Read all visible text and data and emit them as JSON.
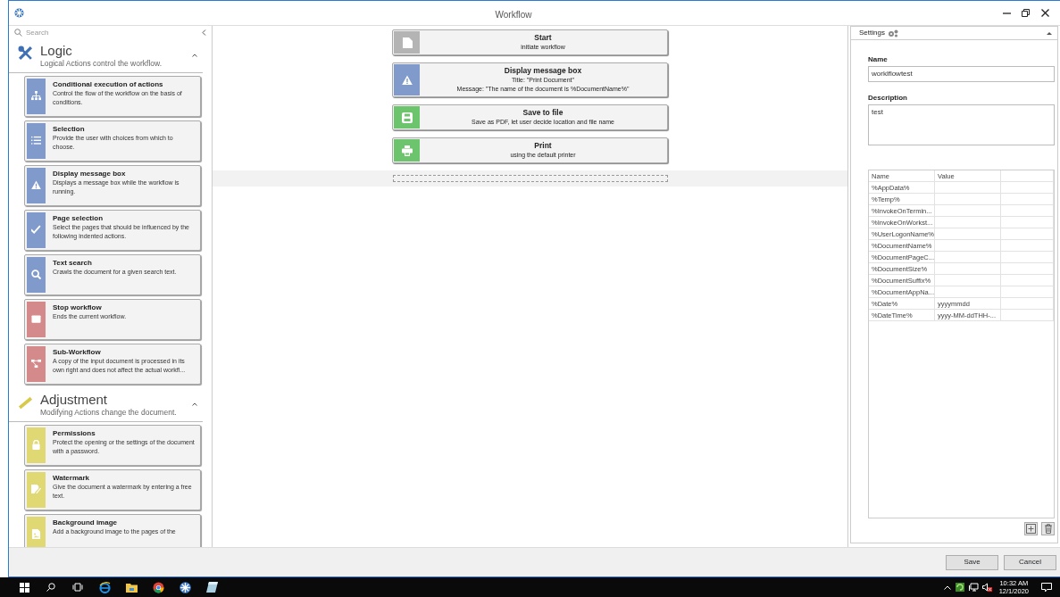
{
  "window": {
    "title": "Workflow"
  },
  "toolbox": {
    "search": {
      "placeholder": "Search"
    },
    "sections": [
      {
        "title": "Logic",
        "subtitle": "Logical Actions control the workflow.",
        "expanded": true,
        "items": [
          {
            "title": "Conditional execution of actions",
            "description": "Control the flow of the workflow on the basis of conditions.",
            "color": "#7f9acb"
          },
          {
            "title": "Selection",
            "description": "Provide the user with choices from which to choose.",
            "color": "#7f9acb"
          },
          {
            "title": "Display message box",
            "description": "Displays a message box while the workflow is running.",
            "color": "#7f9acb"
          },
          {
            "title": "Page selection",
            "description": "Select the pages that should be influenced by the following indented actions.",
            "color": "#7f9acb"
          },
          {
            "title": "Text search",
            "description": "Crawls the document for a given search text.",
            "color": "#7f9acb"
          },
          {
            "title": "Stop workflow",
            "description": "Ends the current workflow.",
            "color": "#d48a8a"
          },
          {
            "title": "Sub-Workflow",
            "description": "A copy of the input document is processed in its own right and does not affect the actual workfl...",
            "color": "#d48a8a"
          }
        ]
      },
      {
        "title": "Adjustment",
        "subtitle": "Modifying Actions change the document.",
        "expanded": true,
        "items": [
          {
            "title": "Permissions",
            "description": "Protect the opening or the settings of the document with a password.",
            "color": "#e0d872"
          },
          {
            "title": "Watermark",
            "description": "Give the document a watermark by entering a free text.",
            "color": "#e0d872"
          },
          {
            "title": "Background image",
            "description": "Add a background image to the pages of the",
            "color": "#e0d872"
          }
        ]
      }
    ]
  },
  "workflow": {
    "steps": [
      {
        "title": "Start",
        "lines": [
          "initiate workflow"
        ],
        "color": "#b4b4b4"
      },
      {
        "title": "Display message box",
        "lines": [
          "Title: \"Print Document\"",
          "Message: \"The name of the document is %DocumentName%\""
        ],
        "color": "#7f9acb"
      },
      {
        "title": "Save to file",
        "lines": [
          "Save as PDF, let user decide location and file name"
        ],
        "color": "#6cc46c"
      },
      {
        "title": "Print",
        "lines": [
          "using the default printer"
        ],
        "color": "#6cc46c"
      }
    ]
  },
  "settings": {
    "title": "Settings",
    "expanded": true,
    "name_label": "Name",
    "name_value": "worklflowtest",
    "description_label": "Description",
    "description_value": "test",
    "variables": {
      "columns": [
        "Name",
        "Value"
      ],
      "rows": [
        {
          "name": "%AppData%",
          "value": ""
        },
        {
          "name": "%Temp%",
          "value": ""
        },
        {
          "name": "%InvokeOnTermin...",
          "value": ""
        },
        {
          "name": "%InvokeOnWorkst...",
          "value": ""
        },
        {
          "name": "%UserLogonName%",
          "value": ""
        },
        {
          "name": "%DocumentName%",
          "value": ""
        },
        {
          "name": "%DocumentPageC...",
          "value": ""
        },
        {
          "name": "%DocumentSize%",
          "value": ""
        },
        {
          "name": "%DocumentSuffix%",
          "value": ""
        },
        {
          "name": "%DocumentAppNa...",
          "value": ""
        },
        {
          "name": "%Date%",
          "value": "yyyymmdd"
        },
        {
          "name": "%DateTime%",
          "value": "yyyy-MM-ddTHH-..."
        }
      ]
    }
  },
  "buttons": [
    "Save",
    "Cancel"
  ],
  "taskbar": {
    "time": "10:32 AM",
    "date": "12/1/2020"
  }
}
